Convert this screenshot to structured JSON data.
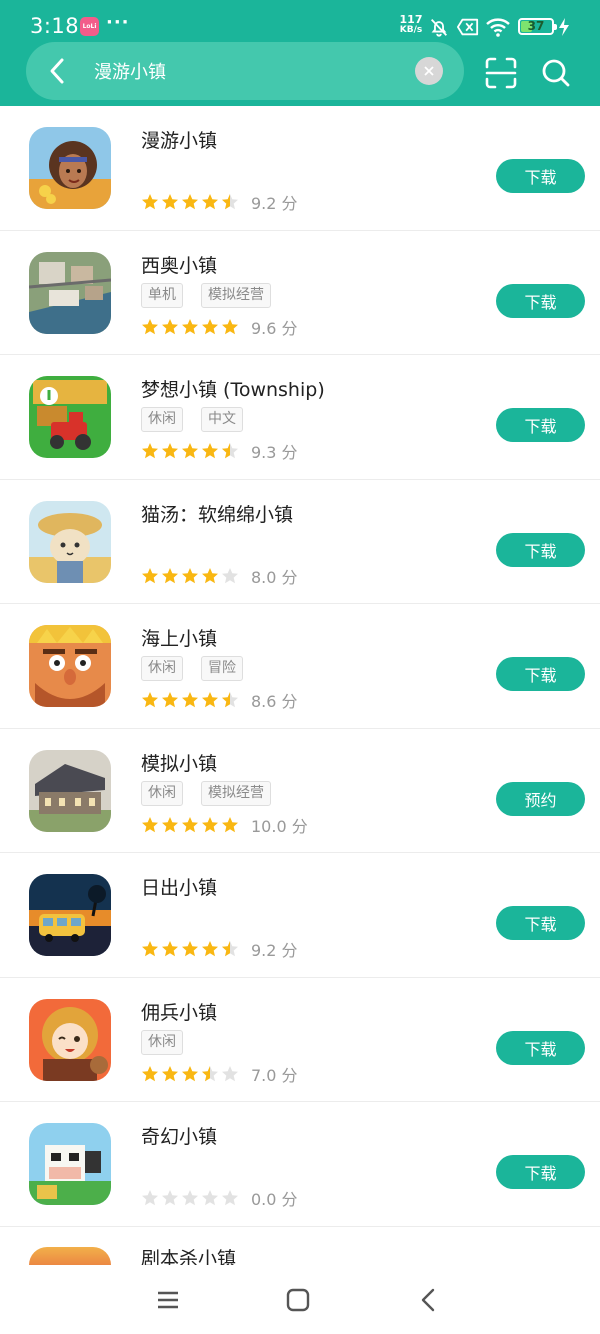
{
  "status_bar": {
    "time": "3:18",
    "app_badge": "LoLi",
    "dots": "···",
    "net_speed_value": "117",
    "net_speed_unit": "KB/s",
    "battery": "37",
    "battery_level": 0.37
  },
  "search": {
    "query": "漫游小镇"
  },
  "colors": {
    "accent": "#1bb59a",
    "star_on": "#f9b712",
    "star_off": "#e2e2e2"
  },
  "apps": [
    {
      "name": "漫游小镇",
      "tags": [],
      "rating": 4.5,
      "score": "9.2 分",
      "button": "下载",
      "icon": "girl-portrait-icon"
    },
    {
      "name": "西奥小镇",
      "tags": [
        "单机",
        "模拟经营"
      ],
      "rating": 5,
      "score": "9.6 分",
      "button": "下载",
      "icon": "city-aerial-icon"
    },
    {
      "name": "梦想小镇 (Township)",
      "tags": [
        "休闲",
        "中文"
      ],
      "rating": 4.5,
      "score": "9.3 分",
      "button": "下载",
      "icon": "tractor-farm-icon"
    },
    {
      "name": "猫汤：软绵绵小镇",
      "tags": [],
      "rating": 4,
      "score": "8.0 分",
      "button": "下载",
      "icon": "cat-farmer-icon"
    },
    {
      "name": "海上小镇",
      "tags": [
        "休闲",
        "冒险"
      ],
      "rating": 4.5,
      "score": "8.6 分",
      "button": "下载",
      "icon": "bearded-king-icon"
    },
    {
      "name": "模拟小镇",
      "tags": [
        "休闲",
        "模拟经营"
      ],
      "rating": 5,
      "score": "10.0 分",
      "button": "预约",
      "icon": "mansion-icon"
    },
    {
      "name": "日出小镇",
      "tags": [],
      "rating": 4.5,
      "score": "9.2 分",
      "button": "下载",
      "icon": "bus-sunset-icon"
    },
    {
      "name": "佣兵小镇",
      "tags": [
        "休闲"
      ],
      "rating": 3.5,
      "score": "7.0 分",
      "button": "下载",
      "icon": "anime-girl-icon"
    },
    {
      "name": "奇幻小镇",
      "tags": [],
      "rating": 0,
      "score": "0.0 分",
      "button": "下载",
      "icon": "cow-farm-icon"
    }
  ],
  "partial_app": {
    "name": "剧本杀小镇",
    "icon": "script-game-icon"
  }
}
